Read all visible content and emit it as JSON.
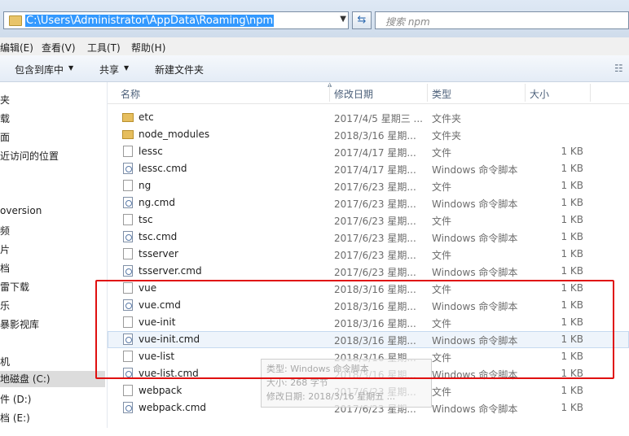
{
  "address": {
    "path": "C:\\Users\\Administrator\\AppData\\Roaming\\npm"
  },
  "search": {
    "placeholder": "搜索 npm"
  },
  "menu": {
    "items": [
      "编辑(E)",
      "查看(V)",
      "工具(T)",
      "帮助(H)"
    ]
  },
  "toolbar": {
    "include": "包含到库中",
    "share": "共享",
    "new_folder": "新建文件夹"
  },
  "nav": {
    "items": [
      "夹",
      "载",
      "面",
      "近访问的位置",
      "oversion",
      "频",
      "片",
      "档",
      "雷下载",
      "乐",
      "暴影视库",
      "机",
      "地磁盘 (C:)",
      "件 (D:)",
      "档 (E:)"
    ]
  },
  "columns": {
    "name": "名称",
    "date": "修改日期",
    "type": "类型",
    "size": "大小"
  },
  "files": [
    {
      "name": "etc",
      "date": "2017/4/5 星期三 ...",
      "type": "文件夹",
      "size": "",
      "icon": "folder"
    },
    {
      "name": "node_modules",
      "date": "2018/3/16 星期...",
      "type": "文件夹",
      "size": "",
      "icon": "folder"
    },
    {
      "name": "lessc",
      "date": "2017/4/17 星期...",
      "type": "文件",
      "size": "1 KB",
      "icon": "file"
    },
    {
      "name": "lessc.cmd",
      "date": "2017/4/17 星期...",
      "type": "Windows 命令脚本",
      "size": "1 KB",
      "icon": "cmd"
    },
    {
      "name": "ng",
      "date": "2017/6/23 星期...",
      "type": "文件",
      "size": "1 KB",
      "icon": "file"
    },
    {
      "name": "ng.cmd",
      "date": "2017/6/23 星期...",
      "type": "Windows 命令脚本",
      "size": "1 KB",
      "icon": "cmd"
    },
    {
      "name": "tsc",
      "date": "2017/6/23 星期...",
      "type": "文件",
      "size": "1 KB",
      "icon": "file"
    },
    {
      "name": "tsc.cmd",
      "date": "2017/6/23 星期...",
      "type": "Windows 命令脚本",
      "size": "1 KB",
      "icon": "cmd"
    },
    {
      "name": "tsserver",
      "date": "2017/6/23 星期...",
      "type": "文件",
      "size": "1 KB",
      "icon": "file"
    },
    {
      "name": "tsserver.cmd",
      "date": "2017/6/23 星期...",
      "type": "Windows 命令脚本",
      "size": "1 KB",
      "icon": "cmd"
    },
    {
      "name": "vue",
      "date": "2018/3/16 星期...",
      "type": "文件",
      "size": "1 KB",
      "icon": "file"
    },
    {
      "name": "vue.cmd",
      "date": "2018/3/16 星期...",
      "type": "Windows 命令脚本",
      "size": "1 KB",
      "icon": "cmd"
    },
    {
      "name": "vue-init",
      "date": "2018/3/16 星期...",
      "type": "文件",
      "size": "1 KB",
      "icon": "file"
    },
    {
      "name": "vue-init.cmd",
      "date": "2018/3/16 星期...",
      "type": "Windows 命令脚本",
      "size": "1 KB",
      "icon": "cmd"
    },
    {
      "name": "vue-list",
      "date": "2018/3/16 星期...",
      "type": "文件",
      "size": "1 KB",
      "icon": "file"
    },
    {
      "name": "vue-list.cmd",
      "date": "2018/3/16 星期...",
      "type": "Windows 命令脚本",
      "size": "1 KB",
      "icon": "cmd"
    },
    {
      "name": "webpack",
      "date": "2017/6/23 星期...",
      "type": "文件",
      "size": "1 KB",
      "icon": "file"
    },
    {
      "name": "webpack.cmd",
      "date": "2017/6/23 星期...",
      "type": "Windows 命令脚本",
      "size": "1 KB",
      "icon": "cmd"
    }
  ],
  "tooltip": {
    "type_line": "类型: Windows 命令脚本",
    "size_line": "大小: 268 字节",
    "date_line": "修改日期: 2018/3/16 星期五 ..."
  },
  "colors": {
    "highlight_box": "#e01010",
    "selection": "#3399ff"
  }
}
